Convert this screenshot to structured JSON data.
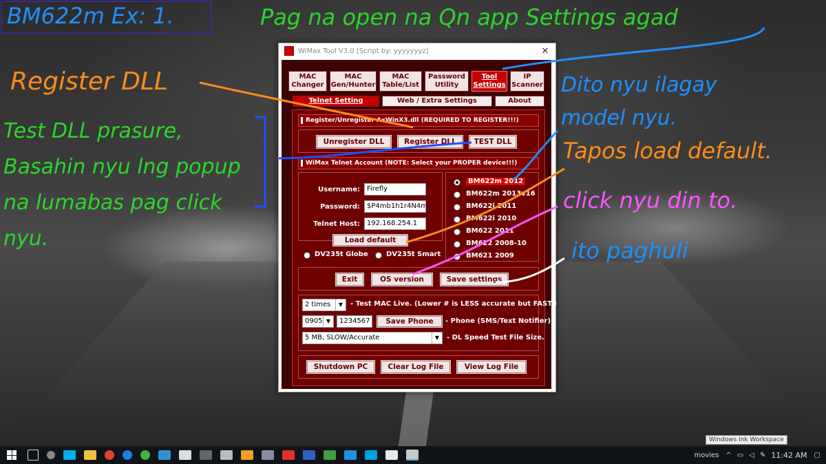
{
  "window": {
    "title": "WiMax Tool V3.0 [Script by: yyyyyyyz]",
    "close_glyph": "✕",
    "tabs": [
      {
        "label": "MAC Changer",
        "active": false
      },
      {
        "label": "MAC Gen/Hunter",
        "active": false
      },
      {
        "label": "MAC Table/List",
        "active": false
      },
      {
        "label": "Password Utility",
        "active": false
      },
      {
        "label": "Tool Settings",
        "active": true
      },
      {
        "label": "IP Scanner",
        "active": false
      }
    ],
    "subtabs": [
      {
        "label": "Telnet Setting",
        "active": true
      },
      {
        "label": "Web / Extra Settings",
        "active": false
      },
      {
        "label": "About",
        "active": false
      }
    ],
    "dll_section": "Register/Unregister AxWinX3.dll (REQUIRED TO REGISTER!!!)",
    "dll_buttons": {
      "unregister": "Unregister DLL",
      "register": "Register DLL",
      "test": "TEST DLL"
    },
    "telnet_section": "WiMax Telnet Account (NOTE: Select your PROPER device!!!)",
    "fields": {
      "username_label": "Username:",
      "username_value": "Firefly",
      "password_label": "Password:",
      "password_value": "$P4mb1h1r4N4m",
      "host_label": "Telnet Host:",
      "host_value": "192.168.254.1"
    },
    "load_default": "Load default",
    "models": [
      {
        "label": "BM622m 2012",
        "selected": true
      },
      {
        "label": "BM622m 2013v16",
        "selected": false
      },
      {
        "label": "BM622i 2011",
        "selected": false
      },
      {
        "label": "BM622i 2010",
        "selected": false
      },
      {
        "label": "BM622 2011",
        "selected": false
      },
      {
        "label": "BM622 2008-10",
        "selected": false
      },
      {
        "label": "BM621 2009",
        "selected": false
      }
    ],
    "dv_options": [
      "DV235t Globe",
      "DV235t Smart"
    ],
    "action_buttons": {
      "exit": "Exit",
      "os": "OS version",
      "save": "Save settings"
    },
    "test_times": "2 times",
    "test_desc": "- Test MAC Live. (Lower # is LESS accurate but FAST.)",
    "phone_prefix": "0905",
    "phone_number": "1234567",
    "save_phone": "Save Phone",
    "phone_desc": "- Phone (SMS/Text Notifier)",
    "dl_speed": "5 MB, SLOW/Accurate",
    "dl_desc": "- DL Speed Test File Size.",
    "bottom_buttons": {
      "shutdown": "Shutdown PC",
      "clear": "Clear Log File",
      "view": "View Log File"
    }
  },
  "annotations": {
    "header": "BM622m Ex: 1.",
    "top": "Pag na open na Qn app Settings agad",
    "register": "Register DLL",
    "test": "Test DLL prasure, Basahin nyu lng popup na lumabas pag click nyu.",
    "model": "Dito nyu ilagay model nyu.",
    "load": "Tapos load default.",
    "click": "click nyu din to.",
    "last": "ito paghuli"
  },
  "taskbar": {
    "tray_label": "movies",
    "time": "11:42 AM",
    "ink_tooltip": "Windows Ink Workspace"
  },
  "colors": {
    "panel": "#6e0000",
    "accent": "#c40000",
    "ink_green": "#2bd62b",
    "ink_orange": "#ff8c1a",
    "ink_blue": "#1e90ff",
    "ink_pink": "#ff55ff"
  }
}
